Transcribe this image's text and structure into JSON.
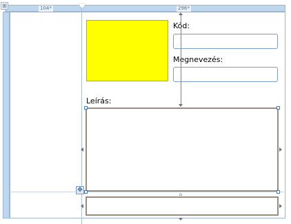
{
  "ruler": {
    "left_column_width": "104*",
    "right_column_width": "296*",
    "corner_glyph": "⊞"
  },
  "form": {
    "code_label": "Kód:",
    "code_value": "",
    "name_label": "Megnevezés:",
    "name_value": "",
    "description_label": "Leírás:",
    "description_value": "",
    "image_placeholder_color": "#ffff00"
  },
  "icons": {
    "move": "move-icon",
    "grip": "grip-icon"
  },
  "glyphs": {
    "move": "✥",
    "grip": "⌂"
  }
}
